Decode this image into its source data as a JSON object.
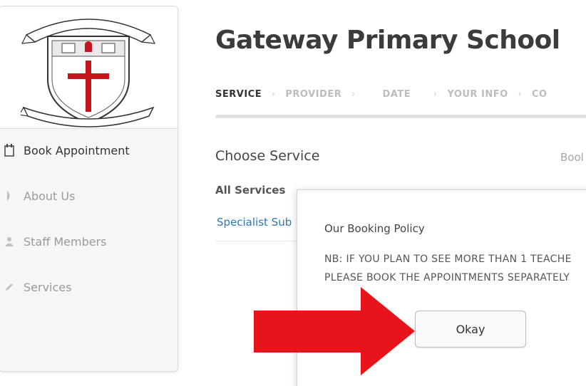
{
  "logo": {
    "banner_top": "GATEWAY PRIMARY",
    "motto": "GREAT IS GOD'S FAITHFULNESS"
  },
  "header": {
    "title": "Gateway Primary School"
  },
  "steps": [
    {
      "label": "SERVICE"
    },
    {
      "label": "PROVIDER"
    },
    {
      "label": "DATE"
    },
    {
      "label": "YOUR INFO"
    },
    {
      "label": "CO"
    }
  ],
  "sidebar": {
    "items": [
      {
        "label": "Book Appointment",
        "icon": "calendar-icon",
        "active": true
      },
      {
        "label": "About Us",
        "icon": "info-icon",
        "active": false
      },
      {
        "label": "Staff Members",
        "icon": "user-icon",
        "active": false
      },
      {
        "label": "Services",
        "icon": "pencil-icon",
        "active": false
      }
    ]
  },
  "main": {
    "section_title": "Choose Service",
    "book_link": "Bool",
    "all_services": "All Services",
    "service_item": "Specialist Sub"
  },
  "modal": {
    "title": "Our Booking Policy",
    "body_line1": "NB: IF YOU PLAN TO SEE MORE THAN 1 TEACHE",
    "body_line2": "PLEASE BOOK THE APPOINTMENTS SEPARATELY",
    "okay_label": "Okay"
  },
  "colors": {
    "accent_link": "#2b78b8",
    "arrow_red": "#e8141b",
    "crest_red": "#c4161c"
  }
}
